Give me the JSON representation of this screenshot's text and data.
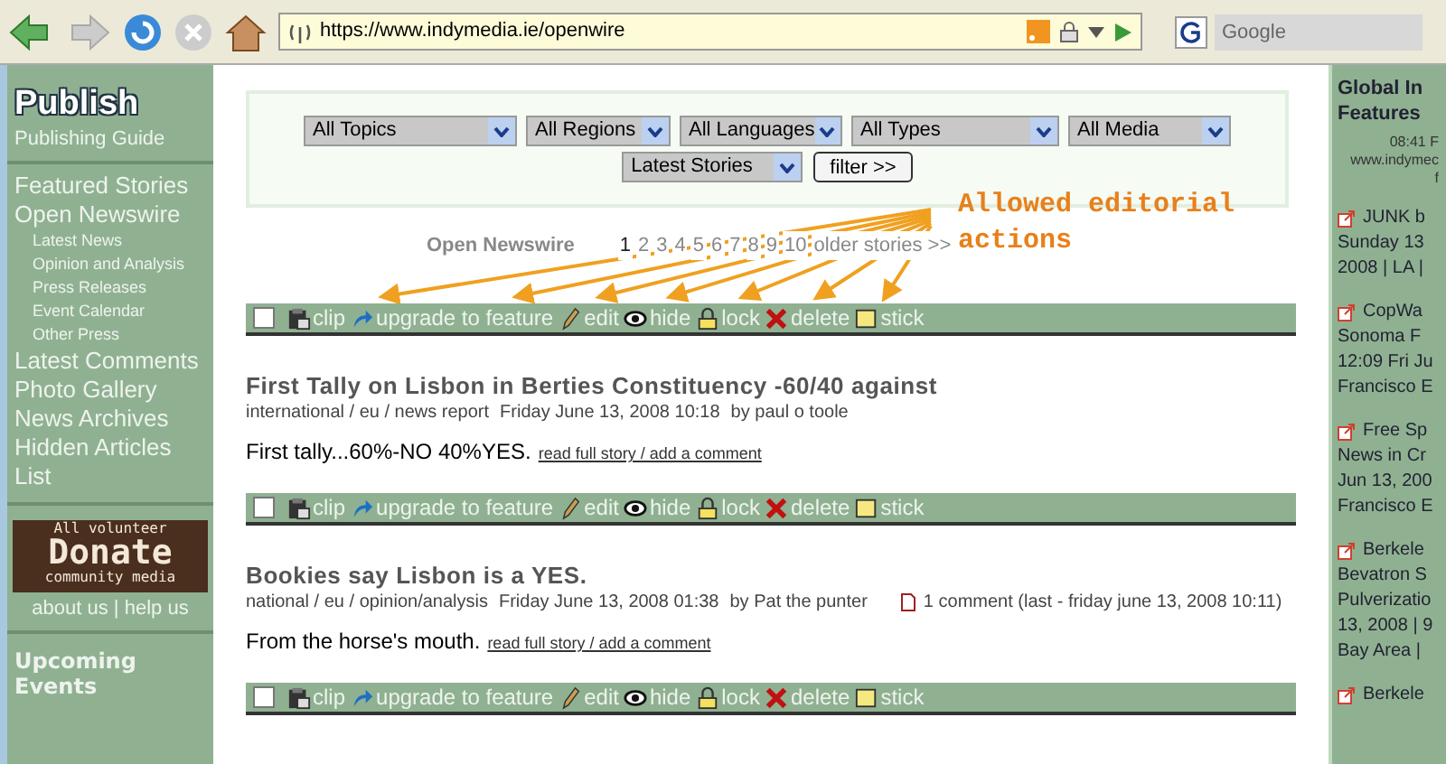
{
  "browser": {
    "url": "https://www.indymedia.ie/openwire",
    "search_placeholder": "Google"
  },
  "left_sidebar": {
    "title": "Publish",
    "subtitle": "Publishing Guide",
    "nav": [
      {
        "label": "Featured Stories"
      },
      {
        "label": "Open Newswire",
        "children": [
          {
            "label": "Latest News"
          },
          {
            "label": "Opinion and Analysis"
          },
          {
            "label": "Press Releases"
          },
          {
            "label": "Event Calendar"
          },
          {
            "label": "Other Press"
          }
        ]
      },
      {
        "label": "Latest Comments"
      },
      {
        "label": "Photo Gallery"
      },
      {
        "label": "News Archives"
      },
      {
        "label": "Hidden Articles List"
      }
    ],
    "banner": {
      "top": "All volunteer",
      "main": "Donate",
      "bottom": "community media"
    },
    "links": "about us | help us",
    "section": "Upcoming Events"
  },
  "filters": {
    "selects": [
      "All Topics",
      "All Regions",
      "All Languages",
      "All Types",
      "All Media",
      "Latest Stories"
    ],
    "button": "filter >>"
  },
  "newswire": {
    "title": "Open Newswire",
    "pages": [
      {
        "label": "1",
        "selected": true
      },
      {
        "label": "2",
        "selected": false
      },
      {
        "label": "3",
        "selected": false
      },
      {
        "label": "4",
        "selected": false
      },
      {
        "label": "5",
        "selected": false
      },
      {
        "label": "6",
        "selected": false
      },
      {
        "label": "7",
        "selected": false
      },
      {
        "label": "8",
        "selected": false
      },
      {
        "label": "9",
        "selected": false
      },
      {
        "label": "10",
        "selected": false
      }
    ],
    "older": "older stories >>"
  },
  "annotation": "Allowed editorial actions",
  "action_bars": [
    {
      "checked": false,
      "actions": [
        {
          "kind": "clip",
          "label": "clip"
        },
        {
          "kind": "upgrade",
          "label": "upgrade to feature"
        },
        {
          "kind": "edit",
          "label": "edit"
        },
        {
          "kind": "hide",
          "label": "hide"
        },
        {
          "kind": "lock",
          "label": "lock"
        },
        {
          "kind": "delete",
          "label": "delete"
        },
        {
          "kind": "stick",
          "label": "stick"
        }
      ]
    },
    {
      "checked": false,
      "actions": [
        {
          "kind": "clip",
          "label": "clip"
        },
        {
          "kind": "upgrade",
          "label": "upgrade to feature"
        },
        {
          "kind": "edit",
          "label": "edit"
        },
        {
          "kind": "hide",
          "label": "hide"
        },
        {
          "kind": "lock",
          "label": "lock"
        },
        {
          "kind": "delete",
          "label": "delete"
        },
        {
          "kind": "stick",
          "label": "stick"
        }
      ]
    },
    {
      "checked": false,
      "actions": [
        {
          "kind": "clip",
          "label": "clip"
        },
        {
          "kind": "upgrade",
          "label": "upgrade to feature"
        },
        {
          "kind": "edit",
          "label": "edit"
        },
        {
          "kind": "hide",
          "label": "hide"
        },
        {
          "kind": "lock",
          "label": "lock"
        },
        {
          "kind": "delete",
          "label": "delete"
        },
        {
          "kind": "stick",
          "label": "stick"
        }
      ]
    }
  ],
  "stories": [
    {
      "title": "First Tally on Lisbon in Berties Constituency -60/40 against",
      "category": "international / eu / news report",
      "date": "Friday June 13, 2008 10:18",
      "author": "by paul o toole",
      "summary": "First tally...60%-NO 40%YES.",
      "link": "read full story / add a comment"
    },
    {
      "title": "Bookies say Lisbon is a YES.",
      "category": "national / eu / opinion/analysis",
      "date": "Friday June 13, 2008 01:38",
      "author": "by Pat the punter",
      "comments": "1 comment (last - friday june 13, 2008 10:11)",
      "summary": "From the horse's mouth.",
      "link": "read full story / add a comment"
    }
  ],
  "right_sidebar": {
    "title": [
      "Global In",
      "Features"
    ],
    "meta": [
      "08:41 F",
      "www.indymec",
      "f"
    ],
    "items": [
      {
        "lines": [
          "JUNK b",
          "Sunday 13",
          "2008 | LA |"
        ]
      },
      {
        "lines": [
          "CopWa",
          "Sonoma F",
          "12:09 Fri Ju",
          "Francisco E"
        ]
      },
      {
        "lines": [
          "Free Sp",
          "News in Cr",
          "Jun 13, 200",
          "Francisco E"
        ]
      },
      {
        "lines": [
          "Berkele",
          "Bevatron S",
          "Pulverizatio",
          "13, 2008 | 9",
          "Bay Area |"
        ]
      },
      {
        "lines": [
          "Berkele"
        ]
      }
    ]
  }
}
